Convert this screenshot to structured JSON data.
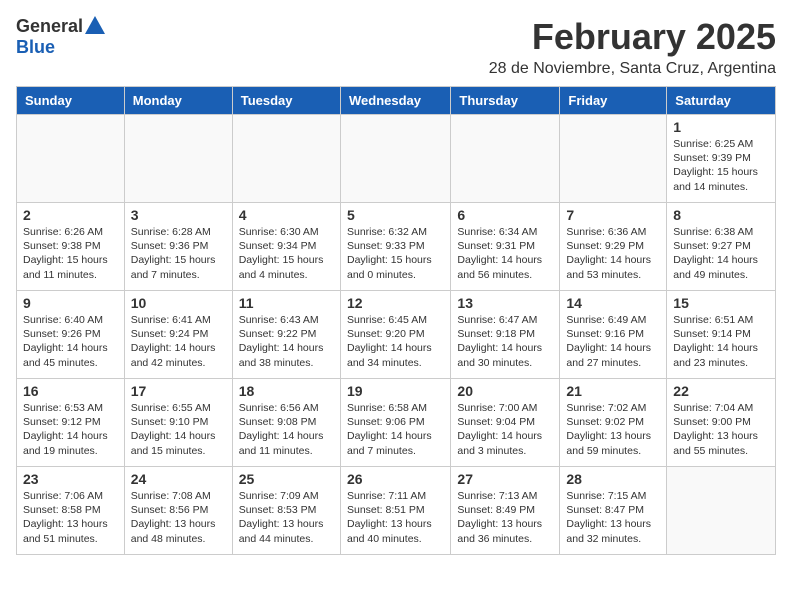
{
  "logo": {
    "general": "General",
    "blue": "Blue"
  },
  "title": "February 2025",
  "subtitle": "28 de Noviembre, Santa Cruz, Argentina",
  "weekdays": [
    "Sunday",
    "Monday",
    "Tuesday",
    "Wednesday",
    "Thursday",
    "Friday",
    "Saturday"
  ],
  "weeks": [
    [
      {
        "day": "",
        "info": ""
      },
      {
        "day": "",
        "info": ""
      },
      {
        "day": "",
        "info": ""
      },
      {
        "day": "",
        "info": ""
      },
      {
        "day": "",
        "info": ""
      },
      {
        "day": "",
        "info": ""
      },
      {
        "day": "1",
        "info": "Sunrise: 6:25 AM\nSunset: 9:39 PM\nDaylight: 15 hours\nand 14 minutes."
      }
    ],
    [
      {
        "day": "2",
        "info": "Sunrise: 6:26 AM\nSunset: 9:38 PM\nDaylight: 15 hours\nand 11 minutes."
      },
      {
        "day": "3",
        "info": "Sunrise: 6:28 AM\nSunset: 9:36 PM\nDaylight: 15 hours\nand 7 minutes."
      },
      {
        "day": "4",
        "info": "Sunrise: 6:30 AM\nSunset: 9:34 PM\nDaylight: 15 hours\nand 4 minutes."
      },
      {
        "day": "5",
        "info": "Sunrise: 6:32 AM\nSunset: 9:33 PM\nDaylight: 15 hours\nand 0 minutes."
      },
      {
        "day": "6",
        "info": "Sunrise: 6:34 AM\nSunset: 9:31 PM\nDaylight: 14 hours\nand 56 minutes."
      },
      {
        "day": "7",
        "info": "Sunrise: 6:36 AM\nSunset: 9:29 PM\nDaylight: 14 hours\nand 53 minutes."
      },
      {
        "day": "8",
        "info": "Sunrise: 6:38 AM\nSunset: 9:27 PM\nDaylight: 14 hours\nand 49 minutes."
      }
    ],
    [
      {
        "day": "9",
        "info": "Sunrise: 6:40 AM\nSunset: 9:26 PM\nDaylight: 14 hours\nand 45 minutes."
      },
      {
        "day": "10",
        "info": "Sunrise: 6:41 AM\nSunset: 9:24 PM\nDaylight: 14 hours\nand 42 minutes."
      },
      {
        "day": "11",
        "info": "Sunrise: 6:43 AM\nSunset: 9:22 PM\nDaylight: 14 hours\nand 38 minutes."
      },
      {
        "day": "12",
        "info": "Sunrise: 6:45 AM\nSunset: 9:20 PM\nDaylight: 14 hours\nand 34 minutes."
      },
      {
        "day": "13",
        "info": "Sunrise: 6:47 AM\nSunset: 9:18 PM\nDaylight: 14 hours\nand 30 minutes."
      },
      {
        "day": "14",
        "info": "Sunrise: 6:49 AM\nSunset: 9:16 PM\nDaylight: 14 hours\nand 27 minutes."
      },
      {
        "day": "15",
        "info": "Sunrise: 6:51 AM\nSunset: 9:14 PM\nDaylight: 14 hours\nand 23 minutes."
      }
    ],
    [
      {
        "day": "16",
        "info": "Sunrise: 6:53 AM\nSunset: 9:12 PM\nDaylight: 14 hours\nand 19 minutes."
      },
      {
        "day": "17",
        "info": "Sunrise: 6:55 AM\nSunset: 9:10 PM\nDaylight: 14 hours\nand 15 minutes."
      },
      {
        "day": "18",
        "info": "Sunrise: 6:56 AM\nSunset: 9:08 PM\nDaylight: 14 hours\nand 11 minutes."
      },
      {
        "day": "19",
        "info": "Sunrise: 6:58 AM\nSunset: 9:06 PM\nDaylight: 14 hours\nand 7 minutes."
      },
      {
        "day": "20",
        "info": "Sunrise: 7:00 AM\nSunset: 9:04 PM\nDaylight: 14 hours\nand 3 minutes."
      },
      {
        "day": "21",
        "info": "Sunrise: 7:02 AM\nSunset: 9:02 PM\nDaylight: 13 hours\nand 59 minutes."
      },
      {
        "day": "22",
        "info": "Sunrise: 7:04 AM\nSunset: 9:00 PM\nDaylight: 13 hours\nand 55 minutes."
      }
    ],
    [
      {
        "day": "23",
        "info": "Sunrise: 7:06 AM\nSunset: 8:58 PM\nDaylight: 13 hours\nand 51 minutes."
      },
      {
        "day": "24",
        "info": "Sunrise: 7:08 AM\nSunset: 8:56 PM\nDaylight: 13 hours\nand 48 minutes."
      },
      {
        "day": "25",
        "info": "Sunrise: 7:09 AM\nSunset: 8:53 PM\nDaylight: 13 hours\nand 44 minutes."
      },
      {
        "day": "26",
        "info": "Sunrise: 7:11 AM\nSunset: 8:51 PM\nDaylight: 13 hours\nand 40 minutes."
      },
      {
        "day": "27",
        "info": "Sunrise: 7:13 AM\nSunset: 8:49 PM\nDaylight: 13 hours\nand 36 minutes."
      },
      {
        "day": "28",
        "info": "Sunrise: 7:15 AM\nSunset: 8:47 PM\nDaylight: 13 hours\nand 32 minutes."
      },
      {
        "day": "",
        "info": ""
      }
    ]
  ]
}
